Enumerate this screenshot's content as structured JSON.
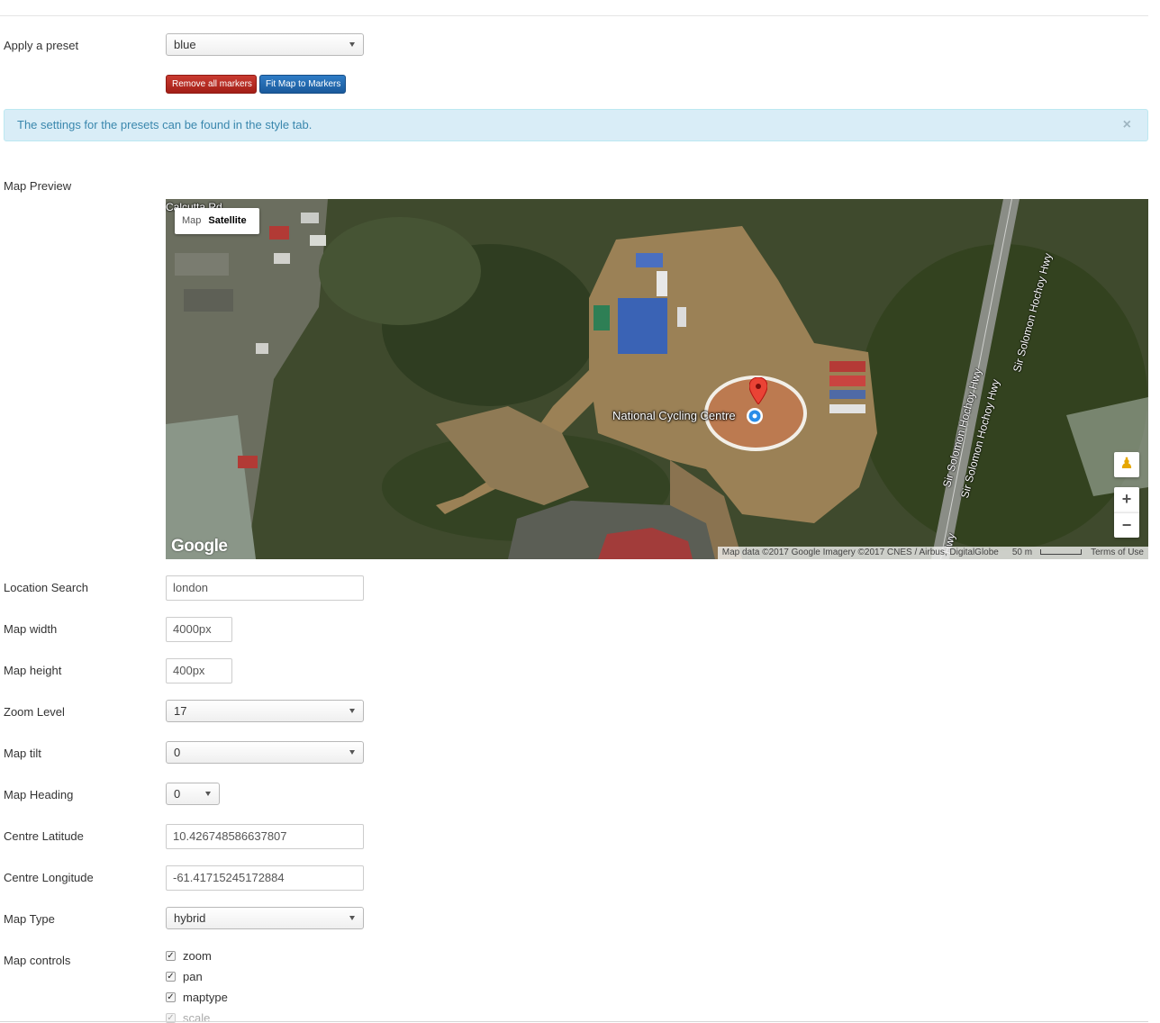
{
  "preset": {
    "label": "Apply a preset",
    "value": "blue",
    "remove_markers_label": "Remove all markers",
    "fit_markers_label": "Fit Map to Markers"
  },
  "alert": {
    "message": "The settings for the presets can be found in the style tab.",
    "close_glyph": "×"
  },
  "map_preview": {
    "label": "Map Preview",
    "type_map_label": "Map",
    "type_satellite_label": "Satellite",
    "marker_label": "National Cycling Centre",
    "road_label_1": "Sir Solomon Hochoy Hwy",
    "road_label_2": "Sir Solomon Hochoy Hwy",
    "road_label_3": "Sir Solomon Hochoy Hwy",
    "corner_label": "Calcutta Rd",
    "hwy_fragment": "Hwy",
    "google_logo": "Google",
    "attribution": "Map data ©2017 Google Imagery ©2017 CNES / Airbus, DigitalGlobe",
    "scale_label": "50 m",
    "terms_label": "Terms of Use",
    "zoom_in_glyph": "+",
    "zoom_out_glyph": "−",
    "pegman_glyph": "♟"
  },
  "fields": {
    "location_search": {
      "label": "Location Search",
      "value": "london"
    },
    "map_width": {
      "label": "Map width",
      "value": "4000px"
    },
    "map_height": {
      "label": "Map height",
      "value": "400px"
    },
    "zoom_level": {
      "label": "Zoom Level",
      "value": "17"
    },
    "map_tilt": {
      "label": "Map tilt",
      "value": "0"
    },
    "map_heading": {
      "label": "Map Heading",
      "value": "0"
    },
    "centre_latitude": {
      "label": "Centre Latitude",
      "value": "10.426748586637807"
    },
    "centre_longitude": {
      "label": "Centre Longitude",
      "value": "-61.41715245172884"
    },
    "map_type": {
      "label": "Map Type",
      "value": "hybrid"
    }
  },
  "map_controls": {
    "label": "Map controls",
    "check_glyph": "✓",
    "items": [
      {
        "label": "zoom",
        "checked": true
      },
      {
        "label": "pan",
        "checked": true
      },
      {
        "label": "maptype",
        "checked": true
      },
      {
        "label": "scale",
        "checked": true
      }
    ]
  },
  "colors": {
    "danger": "#b0271e",
    "primary": "#2266ad",
    "info_bg": "#d9edf7",
    "info_text": "#3a87ad",
    "marker": "#ea4335"
  }
}
